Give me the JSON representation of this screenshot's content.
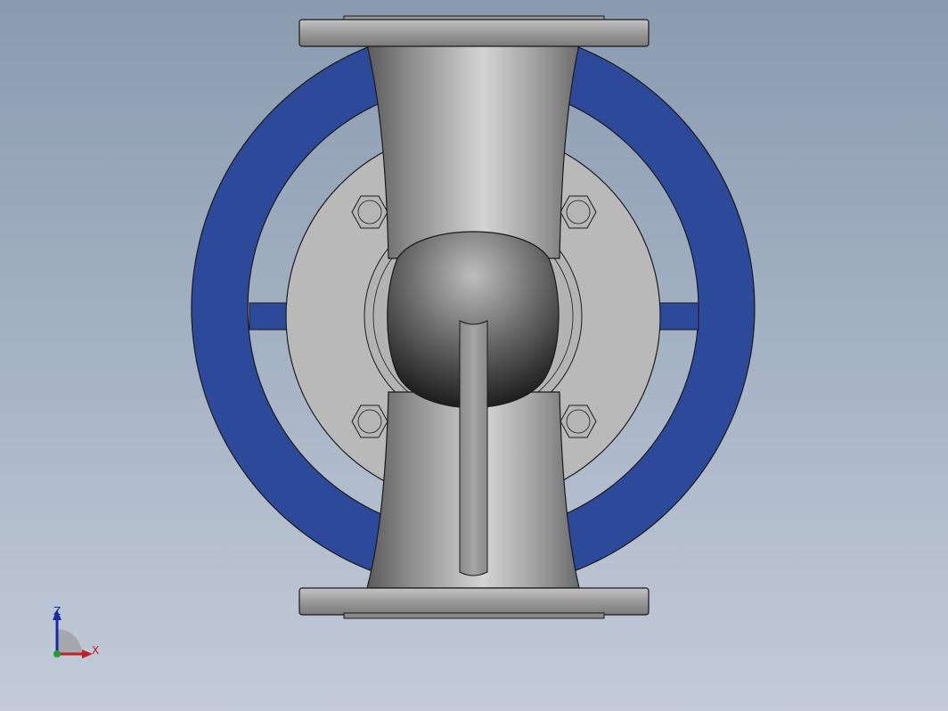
{
  "viewport": {
    "background_top": "#8a9bb0",
    "background_bottom": "#c3cbd8"
  },
  "model": {
    "handwheel_color": "#2d4a9a",
    "body_color": "#b8b8b8",
    "flange_color": "#a8a8a8",
    "edge_color": "#1a1a1a"
  },
  "triad": {
    "z_label": "Z",
    "x_label": "X",
    "z_color": "#1a2aa0",
    "x_color": "#c0202a",
    "y_color": "#20a030"
  }
}
